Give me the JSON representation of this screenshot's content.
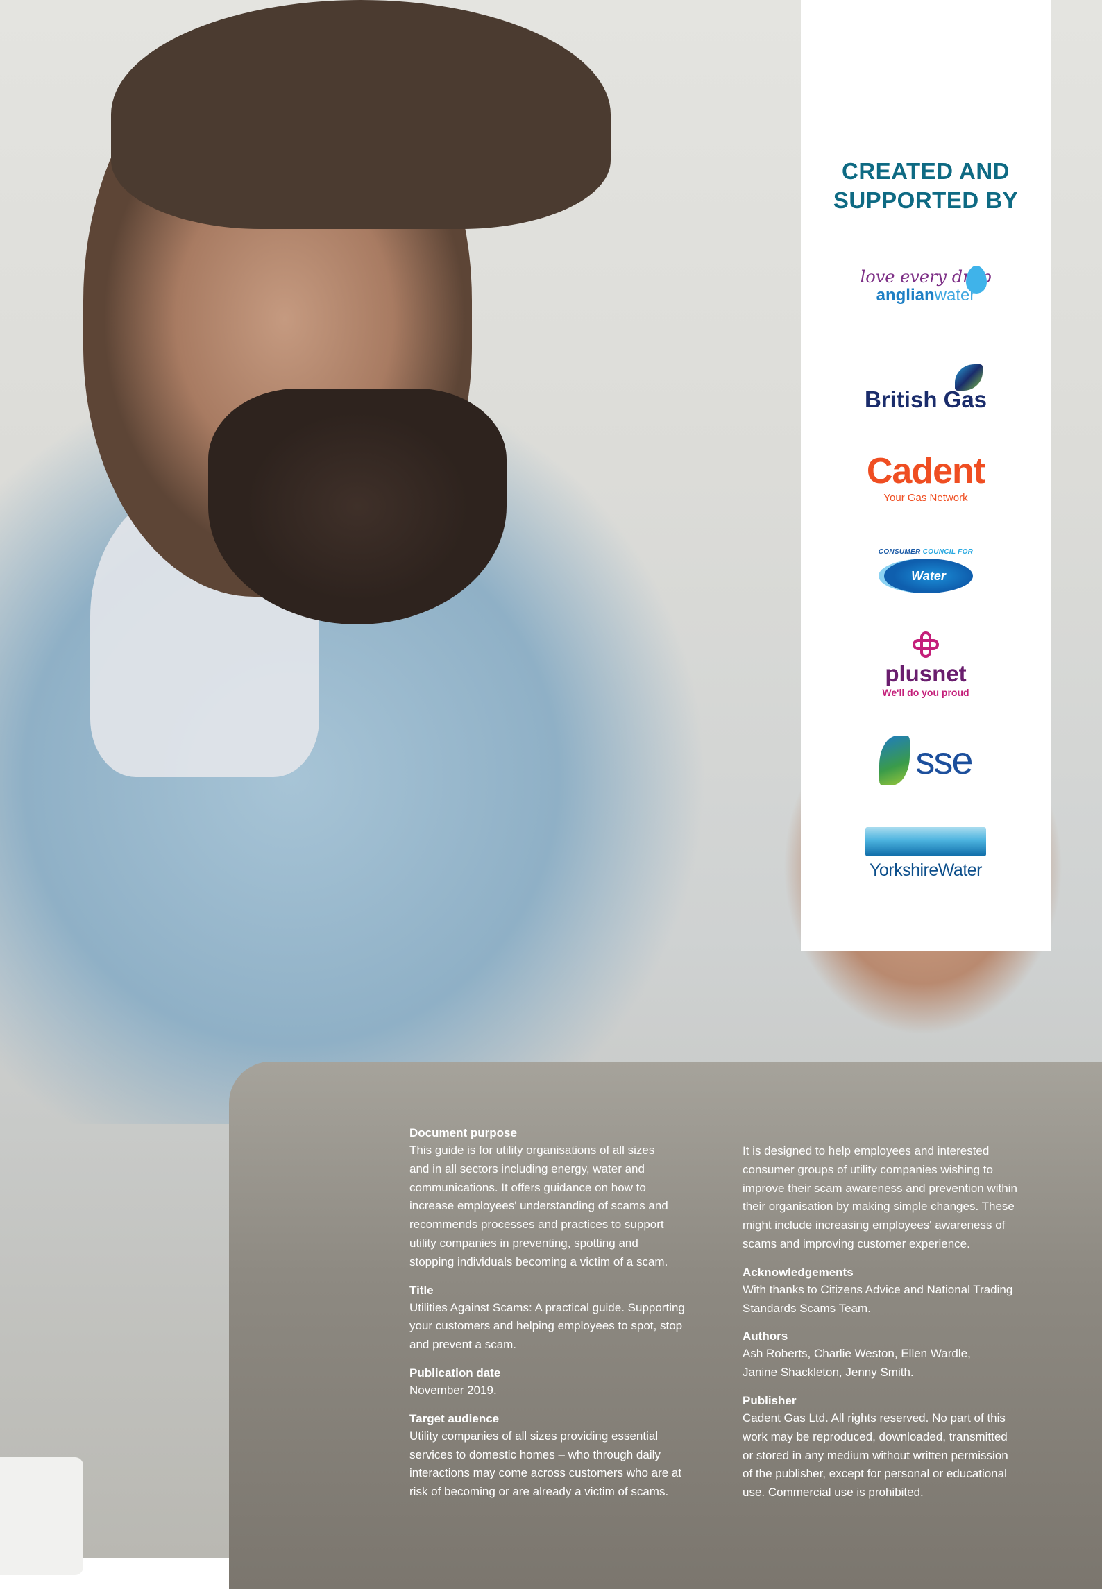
{
  "panel": {
    "title_line1": "CREATED AND",
    "title_line2": "SUPPORTED BY",
    "logos": {
      "anglian": {
        "tagline": "love every drop",
        "name_bold": "anglian",
        "name_light": "water"
      },
      "british_gas": {
        "name": "British Gas"
      },
      "cadent": {
        "name": "Cadent",
        "tagline": "Your Gas Network"
      },
      "ccw": {
        "top_a": "CONSUMER ",
        "top_b": "COUNCIL FOR",
        "name": "Water"
      },
      "plusnet": {
        "name": "plusnet",
        "tagline": "We'll do you proud"
      },
      "sse": {
        "name": "sse"
      },
      "yorkshire": {
        "name": "YorkshireWater"
      }
    }
  },
  "doc": {
    "purpose_heading": "Document purpose",
    "purpose_lines": [
      "This guide is for utility organisations of all sizes",
      "and in all sectors including energy, water and",
      "communications. It offers guidance on how to",
      "increase employees' understanding of scams and",
      "recommends processes and practices to support",
      "utility companies in preventing, spotting and",
      "stopping individuals becoming a victim of a scam."
    ],
    "title_heading": "Title",
    "title_lines": [
      "Utilities Against Scams: A practical guide.  Supporting",
      "your customers and helping employees to spot, stop",
      "and prevent a scam."
    ],
    "pubdate_heading": "Publication date",
    "pubdate_lines": [
      "November 2019."
    ],
    "audience_heading": "Target audience",
    "audience_lines": [
      "Utility companies of all sizes providing essential",
      "services to domestic homes – who through daily",
      "interactions may come across customers who are at",
      "risk of becoming or are already a victim of scams."
    ],
    "designed_lines": [
      "It is designed to help employees and interested",
      "consumer groups of utility companies wishing to",
      "improve their scam awareness and prevention within",
      "their organisation by making simple changes. These",
      "might include increasing employees' awareness of",
      "scams and improving customer experience."
    ],
    "ack_heading": "Acknowledgements",
    "ack_lines": [
      "With thanks to Citizens Advice and National Trading",
      "Standards Scams Team."
    ],
    "authors_heading": "Authors",
    "authors_lines": [
      "Ash Roberts, Charlie Weston, Ellen Wardle,",
      "Janine Shackleton, Jenny Smith."
    ],
    "publisher_heading": "Publisher",
    "publisher_lines": [
      "Cadent Gas Ltd. All rights reserved. No part of this",
      "work may be reproduced, downloaded, transmitted",
      "or stored in any medium without written permission",
      "of the publisher, except for personal or educational",
      "use. Commercial use is prohibited."
    ]
  }
}
